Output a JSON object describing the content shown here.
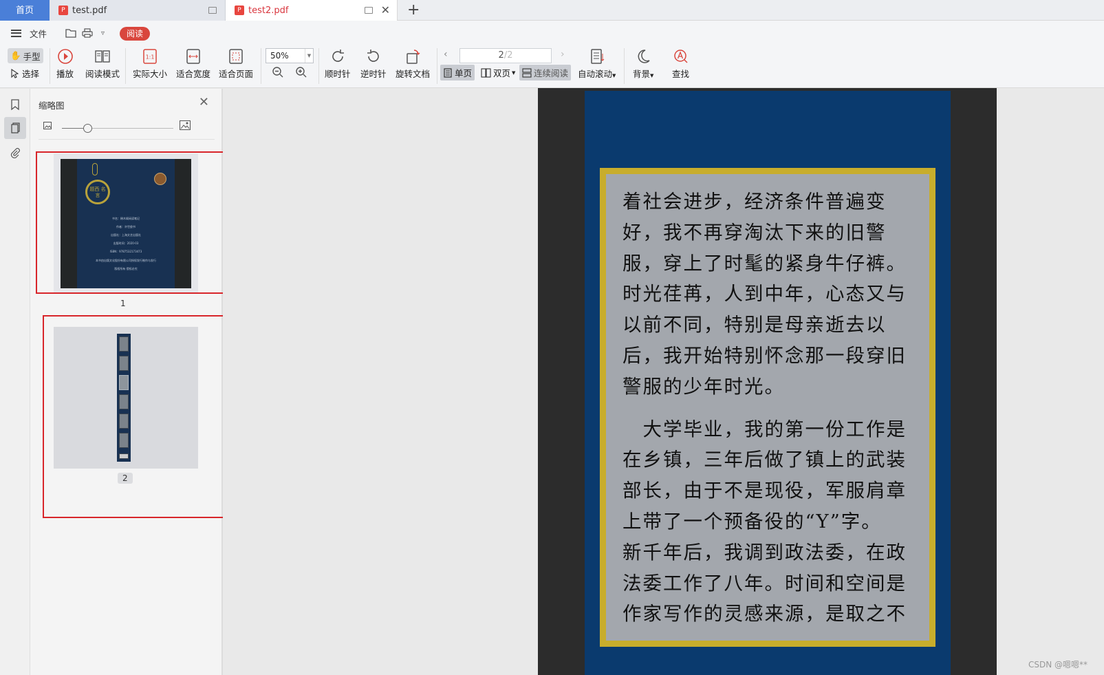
{
  "tabs": {
    "home": "首页",
    "tab1": "test.pdf",
    "tab2": "test2.pdf",
    "new_tab_icon": "plus-icon"
  },
  "menu": {
    "file": "文件",
    "read": "阅读"
  },
  "toolbar": {
    "hand": "手型",
    "select": "选择",
    "play": "播放",
    "read_mode": "阅读模式",
    "actual_size": "实际大小",
    "fit_width": "适合宽度",
    "fit_page": "适合页面",
    "zoom": "50%",
    "clockwise": "顺时针",
    "counterclockwise": "逆时针",
    "rotate_doc": "旋转文档",
    "page_current": "2",
    "page_total": "/2",
    "single_page": "单页",
    "double_page": "双页",
    "continuous": "连续阅读",
    "auto_scroll": "自动滚动",
    "background": "背景",
    "find": "查找",
    "actual_size_glyph": "1:1"
  },
  "panel": {
    "title": "缩略图",
    "slider_value": 0.23,
    "pages": [
      {
        "number": "1",
        "selected": false
      },
      {
        "number": "2",
        "selected": true
      }
    ]
  },
  "thumbnail_cover": {
    "seal_text": "题西 名言",
    "lines": [
      "书名：稀木阁闲读笔记",
      "作者：许世俊书",
      "出版社：上海文艺出版社",
      "出版时间：2020-03",
      "ISBN：9787532173473",
      "本书由出版文化股份有限公司授权发行制作与发行",
      "版权所有 侵权必究"
    ]
  },
  "document": {
    "lines": [
      "着社会进步，经济条件普遍变",
      "好，我不再穿淘汰下来的旧警",
      "服，穿上了时髦的紧身牛仔裤。",
      "时光荏苒，人到中年，心态又与",
      "以前不同，特别是母亲逝去以",
      "后，我开始特别怀念那一段穿旧",
      "警服的少年时光。"
    ],
    "lines2": [
      "　大学毕业，我的第一份工作是",
      "在乡镇，三年后做了镇上的武装",
      "部长，由于不是现役，军服肩章",
      "上带了一个预备役的“Y”字。",
      "新千年后，我调到政法委，在政",
      "法委工作了八年。时间和空间是",
      "作家写作的灵感来源，是取之不"
    ]
  },
  "watermark": "CSDN @嗯嗯**",
  "colors": {
    "accent_blue": "#4a7fd8",
    "accent_red": "#d9463d",
    "highlight_box": "#d8252a"
  }
}
